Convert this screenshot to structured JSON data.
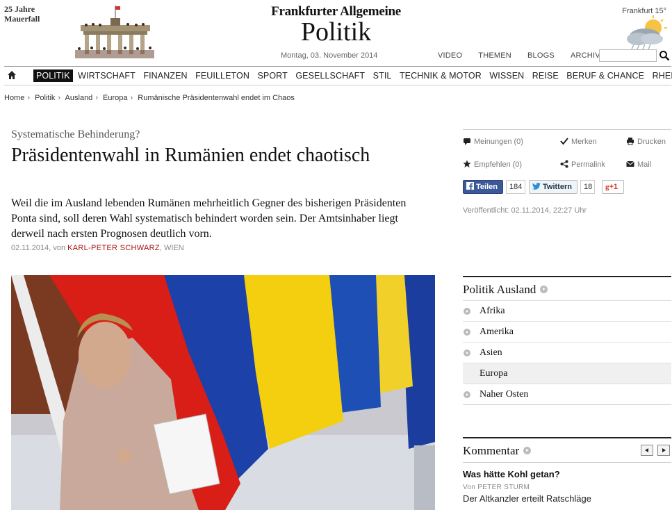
{
  "header": {
    "mauerfall_line1": "25 Jahre",
    "mauerfall_line2": "Mauerfall",
    "logo": "Frankfurter Allgemeine",
    "section": "Politik",
    "date": "Montag, 03. November 2014",
    "weather": "Frankfurt 15°",
    "top_links": [
      "VIDEO",
      "THEMEN",
      "BLOGS",
      "ARCHIV"
    ],
    "search_placeholder": ""
  },
  "nav": {
    "items": [
      "POLITIK",
      "WIRTSCHAFT",
      "FINANZEN",
      "FEUILLETON",
      "SPORT",
      "GESELLSCHAFT",
      "STIL",
      "TECHNIK & MOTOR",
      "WISSEN",
      "REISE",
      "BERUF & CHANCE",
      "RHEIN-MAIN"
    ],
    "active": "POLITIK"
  },
  "breadcrumb": [
    "Home",
    "Politik",
    "Ausland",
    "Europa",
    "Rumänische Präsidentenwahl endet im Chaos"
  ],
  "article": {
    "kicker": "Systematische Behinderung?",
    "headline": "Präsidentenwahl in Rumänien endet chaotisch",
    "teaser": "Weil die im Ausland lebenden Rumänen mehrheitlich Gegner des bisherigen Präsidenten Ponta sind, soll deren Wahl systematisch behindert worden sein. Der Amtsinhaber liegt derweil nach ersten Prognosen deutlich vorn.",
    "date": "02.11.2014",
    "by": ", von ",
    "author": "KARL-PETER SCHWARZ",
    "location": ", WIEN"
  },
  "tools": {
    "meinungen": "Meinungen (0)",
    "merken": "Merken",
    "drucken": "Drucken",
    "empfehlen": "Empfehlen (0)",
    "permalink": "Permalink",
    "mail": "Mail",
    "fb_label": "Teilen",
    "fb_count": "184",
    "tw_label": "Twittern",
    "tw_count": "18",
    "gplus_label": "+1",
    "published": "Veröffentlicht: 02.11.2014, 22:27 Uhr"
  },
  "ausland": {
    "title": "Politik Ausland",
    "items": [
      "Afrika",
      "Amerika",
      "Asien",
      "Europa",
      "Naher Osten"
    ],
    "active": "Europa"
  },
  "kommentar": {
    "title": "Kommentar",
    "headline": "Was hätte Kohl getan?",
    "author": "Von PETER STURM",
    "teaser": "Der Altkanzler erteilt Ratschläge"
  },
  "colors": {
    "accent_red": "#aa1111",
    "facebook": "#3b5998",
    "twitter": "#2f8fcf",
    "gplus": "#d23a2a"
  }
}
